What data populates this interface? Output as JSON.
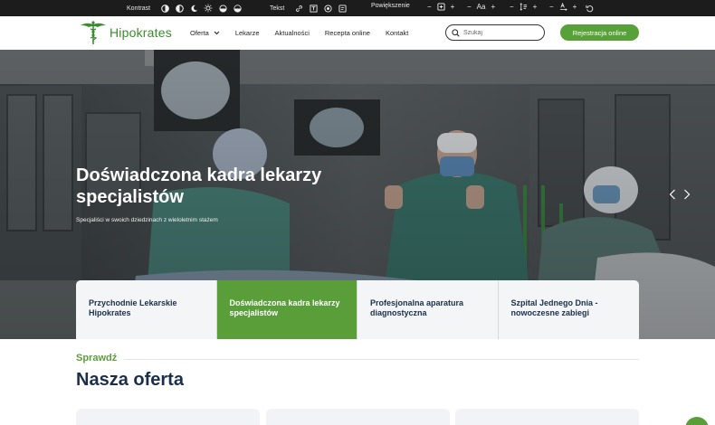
{
  "accessibility_bar": {
    "contrast_label": "Kontrast",
    "text_label": "Tekst",
    "zoom_label": "Powiększenie",
    "font_size_control": "Aa",
    "minus": "−",
    "plus": "+"
  },
  "header": {
    "logo_text": "Hipokrates",
    "nav": [
      "Oferta",
      "Lekarze",
      "Aktualności",
      "Recepta online",
      "Kontakt"
    ],
    "search_placeholder": "Szukaj",
    "register_button": "Rejestracja online"
  },
  "hero": {
    "title": "Doświadczona kadra lekarzy specjalistów",
    "subtitle": "Specjaliści w swoich dziedzinach z wieloletnim stażem"
  },
  "tabs": [
    {
      "label": "Przychodnie Lekarskie Hipokrates",
      "active": false
    },
    {
      "label": "Doświadczona kadra lekarzy specjalistów",
      "active": true
    },
    {
      "label": "Profesjonalna aparatura diagnostyczna",
      "active": false
    },
    {
      "label": "Szpital Jednego Dnia - nowoczesne zabiegi",
      "active": false
    }
  ],
  "section": {
    "kicker": "Sprawdź",
    "title": "Nasza oferta"
  },
  "colors": {
    "brand_green": "#5a9e3a",
    "navy": "#1b2e4a",
    "topbar": "#1c1c1c"
  }
}
